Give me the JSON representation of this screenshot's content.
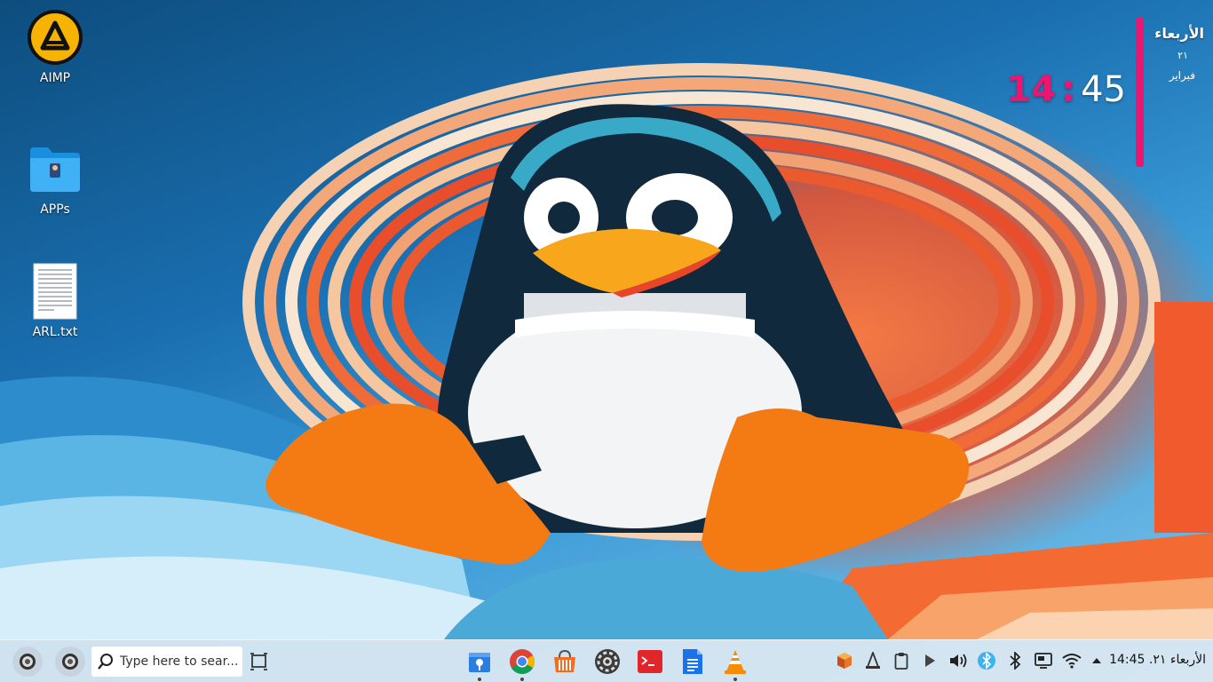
{
  "desktop": {
    "icons": [
      {
        "label": "AIMP",
        "icon": "aimp-icon"
      },
      {
        "label": "APPs",
        "icon": "folder-icon"
      },
      {
        "label": "ARL.txt",
        "icon": "text-file-icon"
      }
    ]
  },
  "clock_widget": {
    "day": "الأربعاء",
    "date": "٢١",
    "month": "فبراير",
    "hour": "14",
    "separator": ":",
    "minute": "45",
    "accent_color": "#ec1570"
  },
  "taskbar": {
    "search": {
      "placeholder": "Type here to sear..."
    },
    "pinned_apps": [
      {
        "name": "store-app-icon",
        "running": true
      },
      {
        "name": "chrome-icon",
        "running": true
      },
      {
        "name": "software-center-icon",
        "running": false
      },
      {
        "name": "settings-gear-app-icon",
        "running": false
      },
      {
        "name": "terminal-icon",
        "running": false
      },
      {
        "name": "document-editor-icon",
        "running": false
      },
      {
        "name": "vlc-icon",
        "running": true
      }
    ],
    "tray": {
      "icons": [
        "package-icon",
        "vlc-tray-icon",
        "clipboard-icon",
        "media-play-icon",
        "volume-icon",
        "bluetooth-active-icon",
        "bluetooth-icon",
        "display-icon",
        "wifi-icon",
        "chevron-up-icon"
      ],
      "clock_text": "الأربعاء ٢١. 14:45"
    }
  }
}
